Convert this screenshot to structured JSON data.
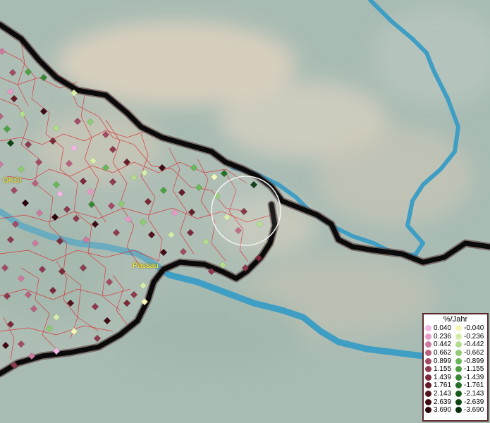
{
  "labels": {
    "gkst": "GKSt",
    "passau": "Passau"
  },
  "legend": {
    "title": "%/Jahr",
    "positive": [
      {
        "value": "0.040",
        "color": "#f2b8e4"
      },
      {
        "value": "0.236",
        "color": "#e79ac6"
      },
      {
        "value": "0.442",
        "color": "#cc7b9f"
      },
      {
        "value": "0.662",
        "color": "#b8627f"
      },
      {
        "value": "0.899",
        "color": "#a24c64"
      },
      {
        "value": "1.155",
        "color": "#8e3a4f"
      },
      {
        "value": "1.439",
        "color": "#7a2a3a"
      },
      {
        "value": "1.761",
        "color": "#661d2b"
      },
      {
        "value": "2.143",
        "color": "#52131f"
      },
      {
        "value": "2.639",
        "color": "#3f0b15"
      },
      {
        "value": "3.690",
        "color": "#2a050c"
      }
    ],
    "negative": [
      {
        "value": "-0.040",
        "color": "#f3f6b9"
      },
      {
        "value": "-0.236",
        "color": "#d6edaa"
      },
      {
        "value": "-0.442",
        "color": "#b4dc8f"
      },
      {
        "value": "-0.662",
        "color": "#8fcb73"
      },
      {
        "value": "-0.899",
        "color": "#6bb658"
      },
      {
        "value": "-1.155",
        "color": "#4e9f43"
      },
      {
        "value": "-1.439",
        "color": "#388833"
      },
      {
        "value": "-1.761",
        "color": "#257026"
      },
      {
        "value": "-2.143",
        "color": "#175a1b"
      },
      {
        "value": "-2.639",
        "color": "#0d4512"
      },
      {
        "value": "-3.690",
        "color": "#06300a"
      }
    ]
  }
}
